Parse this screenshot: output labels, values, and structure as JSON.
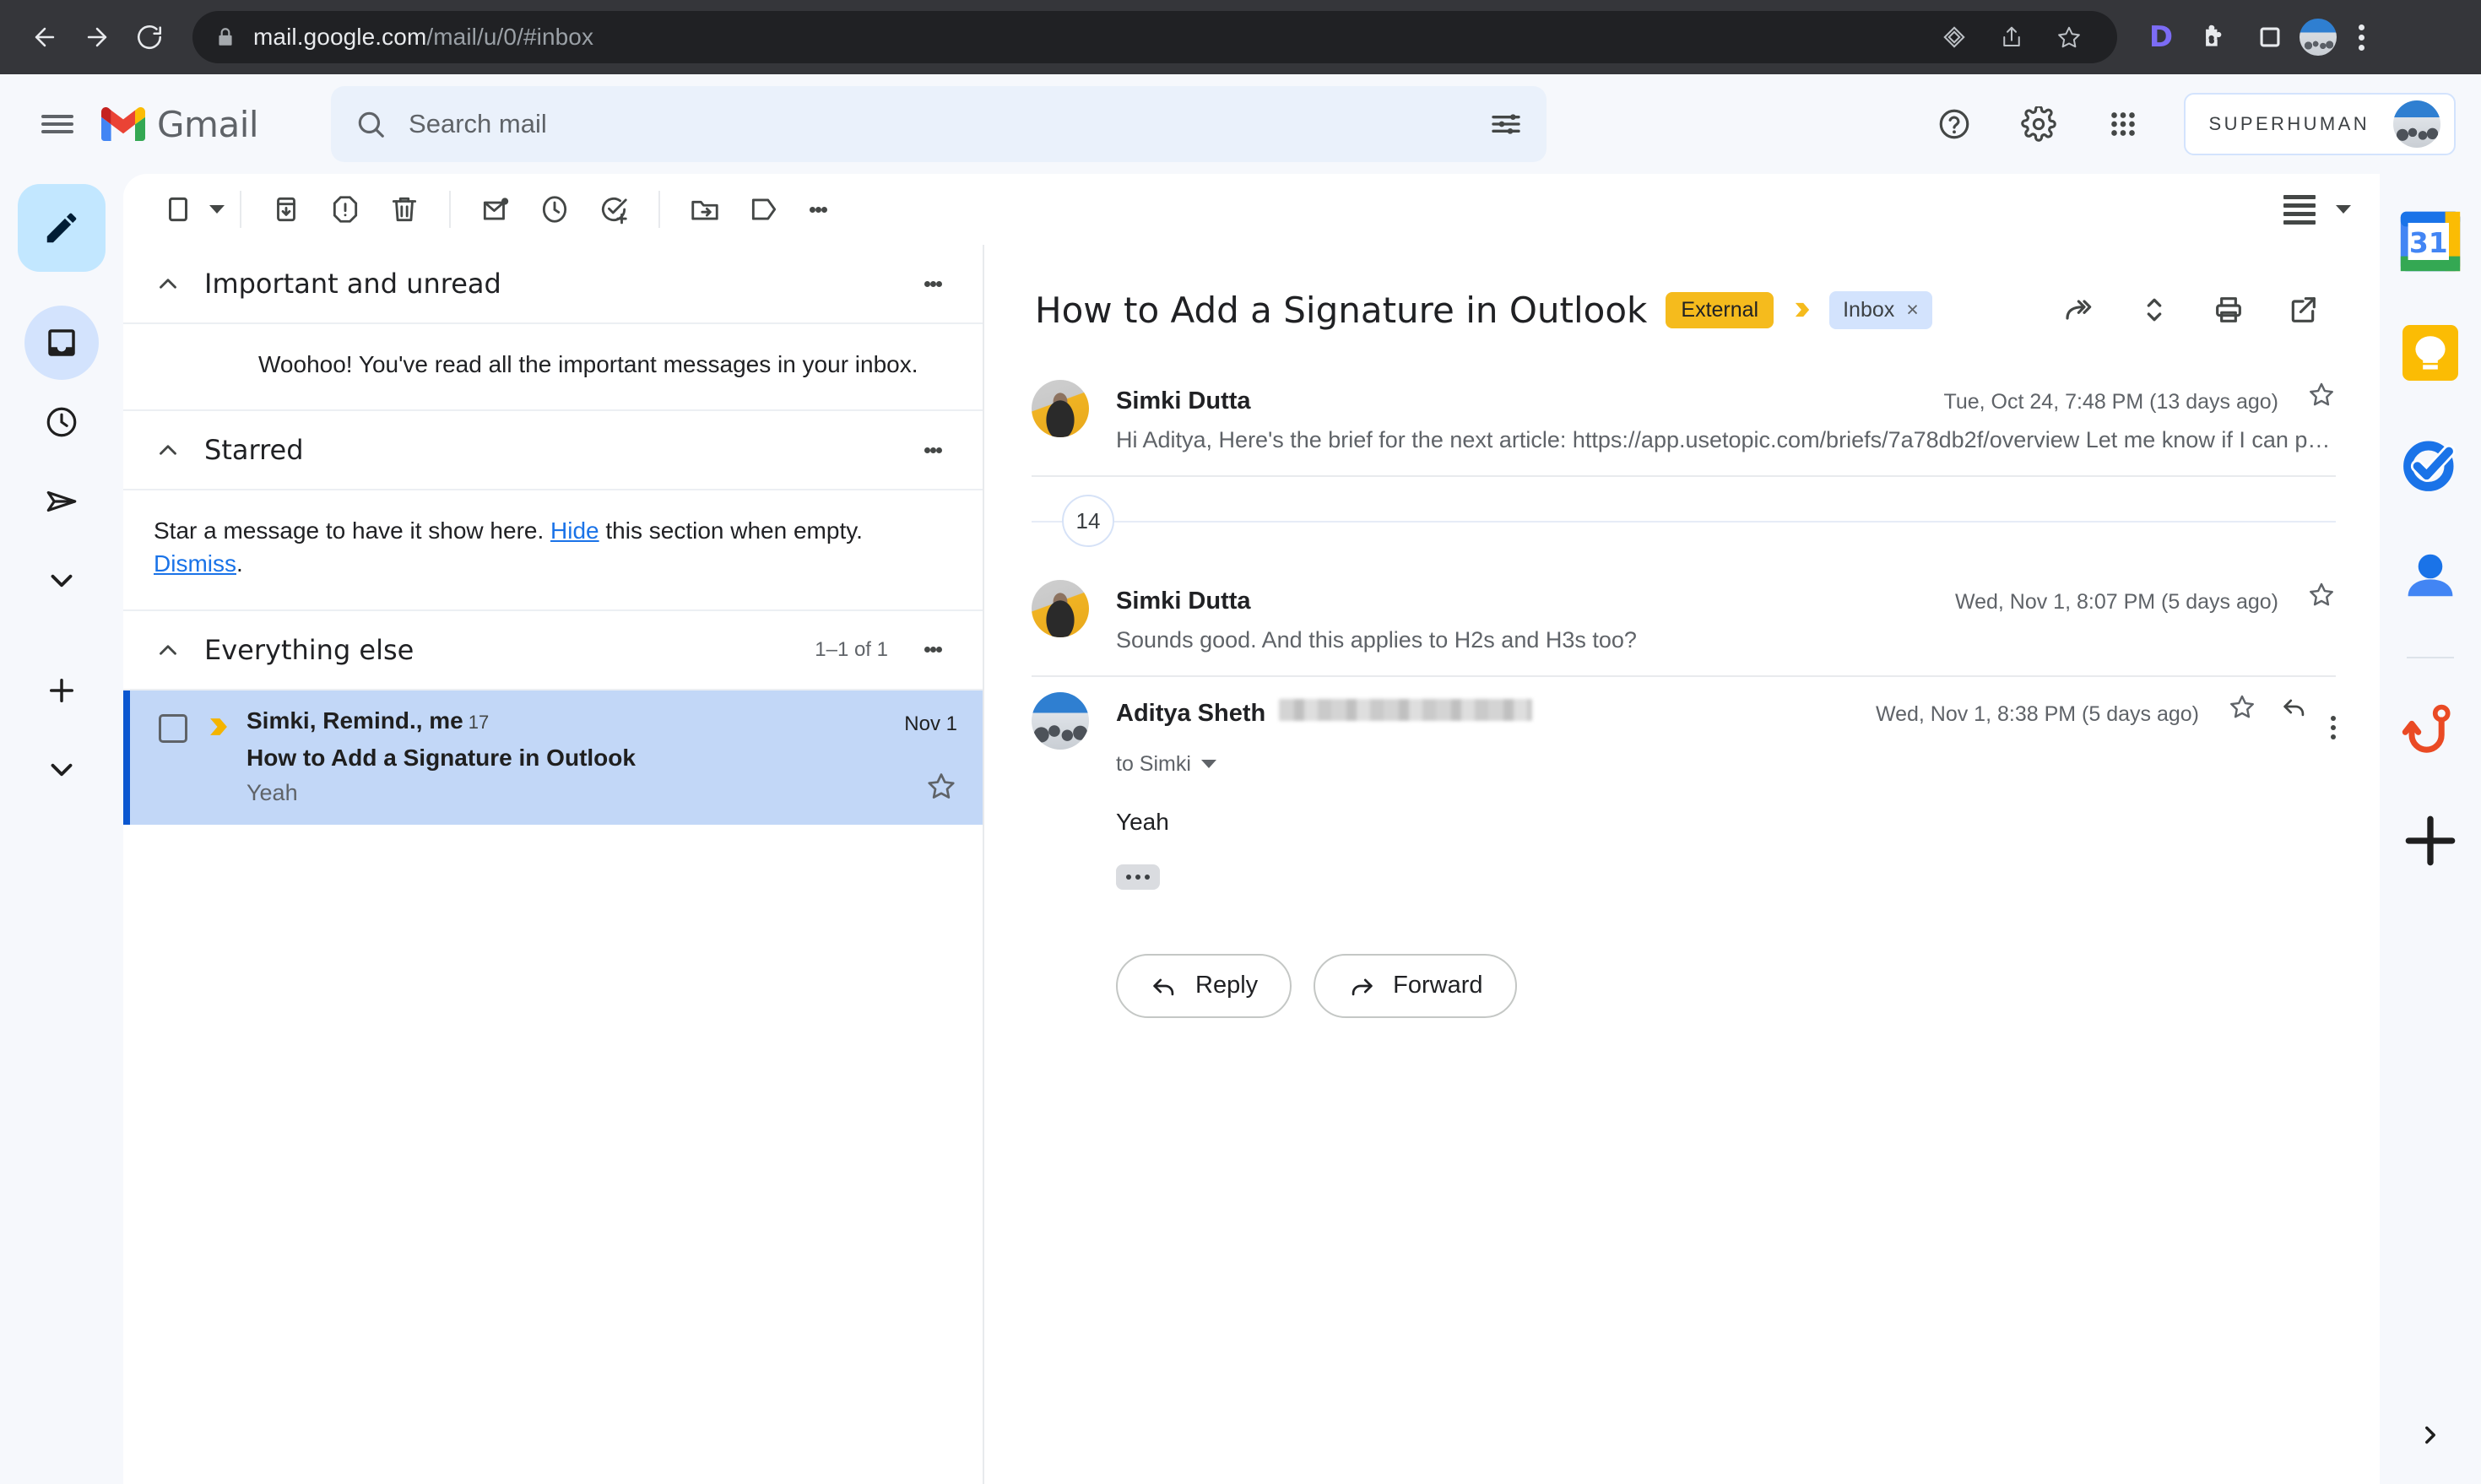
{
  "browser": {
    "url_domain": "mail.google.com",
    "url_path": "/mail/u/0/#inbox",
    "back_icon": "back-arrow-icon",
    "forward_icon": "forward-arrow-icon",
    "reload_icon": "reload-icon",
    "lock_icon": "lock-icon",
    "extension_letter": "D"
  },
  "header": {
    "brand": "Gmail",
    "search_placeholder": "Search mail",
    "search_value": "",
    "account_label": "SUPERHUMAN"
  },
  "toolbar": {
    "select_all": "select-all-checkbox",
    "archive": "Archive",
    "report_spam": "Report spam",
    "delete": "Delete",
    "mark_unread": "Mark as unread",
    "snooze": "Snooze",
    "add_to_tasks": "Add to tasks",
    "move_to": "Move to",
    "labels": "Labels",
    "more": "More"
  },
  "sections": [
    {
      "title": "Important and unread",
      "count": "",
      "note": "Woohoo! You've read all the important messages in your inbox.",
      "note_indent": true
    },
    {
      "title": "Starred",
      "count": "",
      "note_prefix": "Star a message to have it show here. ",
      "note_link1": "Hide",
      "note_mid": " this section when empty. ",
      "note_link2": "Dismiss",
      "note_suffix": "."
    },
    {
      "title": "Everything else",
      "count": "1–1 of 1"
    }
  ],
  "mail_row": {
    "senders": "Simki, Remind., me",
    "message_count": "17",
    "subject": "How to Add a Signature in Outlook",
    "snippet": "Yeah",
    "date": "Nov 1"
  },
  "thread": {
    "subject": "How to Add a Signature in Outlook",
    "tag_external": "External",
    "label_inbox": "Inbox",
    "label_close": "×",
    "actions": {
      "forward_all": "forward-all-icon",
      "expand_collapse": "expand-collapse-icon",
      "print": "print-icon",
      "open_new_window": "open-in-new-window-icon"
    },
    "collapsed_count": "14",
    "messages": [
      {
        "sender": "Simki Dutta",
        "date": "Tue, Oct 24, 7:48 PM (13 days ago)",
        "snippet": "Hi Aditya, Here's the brief for the next article: https://app.usetopic.com/briefs/7a78db2f/overview Let me know if I can proce…"
      },
      {
        "sender": "Simki Dutta",
        "date": "Wed, Nov 1, 8:07 PM (5 days ago)",
        "snippet": "Sounds good. And this applies to H2s and H3s too?"
      },
      {
        "sender": "Aditya Sheth",
        "date": "Wed, Nov 1, 8:38 PM (5 days ago)",
        "to_line": "to Simki",
        "body": "Yeah"
      }
    ],
    "reply_label": "Reply",
    "forward_label": "Forward"
  },
  "left_rail": {
    "compose": "compose-pencil",
    "items": [
      "inbox-icon",
      "snoozed-clock-icon",
      "sent-icon",
      "more-chevron-icon",
      "add-icon",
      "expand-chevron-icon"
    ]
  },
  "right_rail": {
    "items": [
      "google-calendar-icon",
      "google-keep-icon",
      "google-tasks-icon",
      "google-contacts-icon",
      "hook-addon-icon",
      "add-addon-icon"
    ],
    "expand": "expand-panel-icon"
  },
  "colors": {
    "accent": "#0b57d0",
    "selected_row": "#c2d7f7",
    "external_tag": "#f5bb1d",
    "inbox_tag": "#d3e3fd",
    "link": "#1a73e8"
  }
}
